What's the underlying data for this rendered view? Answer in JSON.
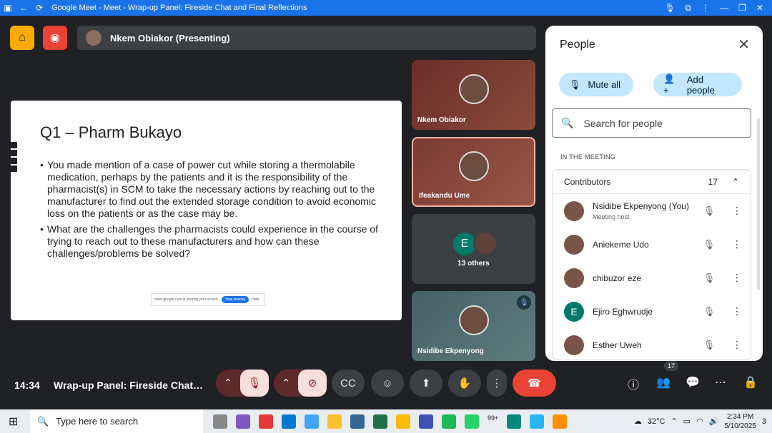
{
  "window": {
    "title": "Google Meet - Meet - Wrap-up Panel: Fireside Chat and Final Reflections"
  },
  "presenting": {
    "label": "Nkem Obiakor (Presenting)"
  },
  "slide": {
    "title": "Q1 – Pharm Bukayo",
    "bullets": [
      "You made mention of a case of power cut while storing a thermolabile medication, perhaps by the patients and it is the responsibility of the pharmacist(s) in SCM to take the necessary actions by reaching out to the manufacturer to find out the extended storage condition to avoid economic loss on the patients or as the case may be.",
      "What are the challenges the pharmacists could experience in the course of trying to reach out to these manufacturers and how can these challenges/problems be solved?"
    ],
    "share_bar": {
      "text": "meet.google.com is sharing your screen.",
      "stop_label": "Stop sharing",
      "hide_label": "Hide"
    }
  },
  "tiles": [
    {
      "name": "Nkem Obiakor"
    },
    {
      "name": "Ifeakandu Ume"
    },
    {
      "name": "13 others",
      "initial": "E"
    },
    {
      "name": "Nsidibe Ekpenyong"
    }
  ],
  "people_panel": {
    "title": "People",
    "mute_all_label": "Mute all",
    "add_people_label": "Add people",
    "search_placeholder": "Search for people",
    "section_label": "IN THE MEETING",
    "contributors_label": "Contributors",
    "contributors_count": "17",
    "participants": [
      {
        "name": "Nsidibe Ekpenyong (You)",
        "sub": "Meeting host"
      },
      {
        "name": "Aniekeme Udo",
        "sub": ""
      },
      {
        "name": "chibuzor eze",
        "sub": ""
      },
      {
        "name": "Ejiro Eghwrudje",
        "sub": "",
        "initial": "E"
      },
      {
        "name": "Esther Uweh",
        "sub": ""
      }
    ]
  },
  "bottom": {
    "time": "14:34",
    "meeting_title": "Wrap-up Panel: Fireside Chat and Final Reflections",
    "people_badge": "17"
  },
  "taskbar": {
    "search_placeholder": "Type here to search",
    "badge": "99+",
    "weather": "32°C",
    "time": "2:34 PM",
    "date": "5/10/2025",
    "notifications": "3"
  },
  "colors": {
    "accent": "#1a73e8",
    "end_call": "#ea4335",
    "pill": "#c2e7ff"
  }
}
